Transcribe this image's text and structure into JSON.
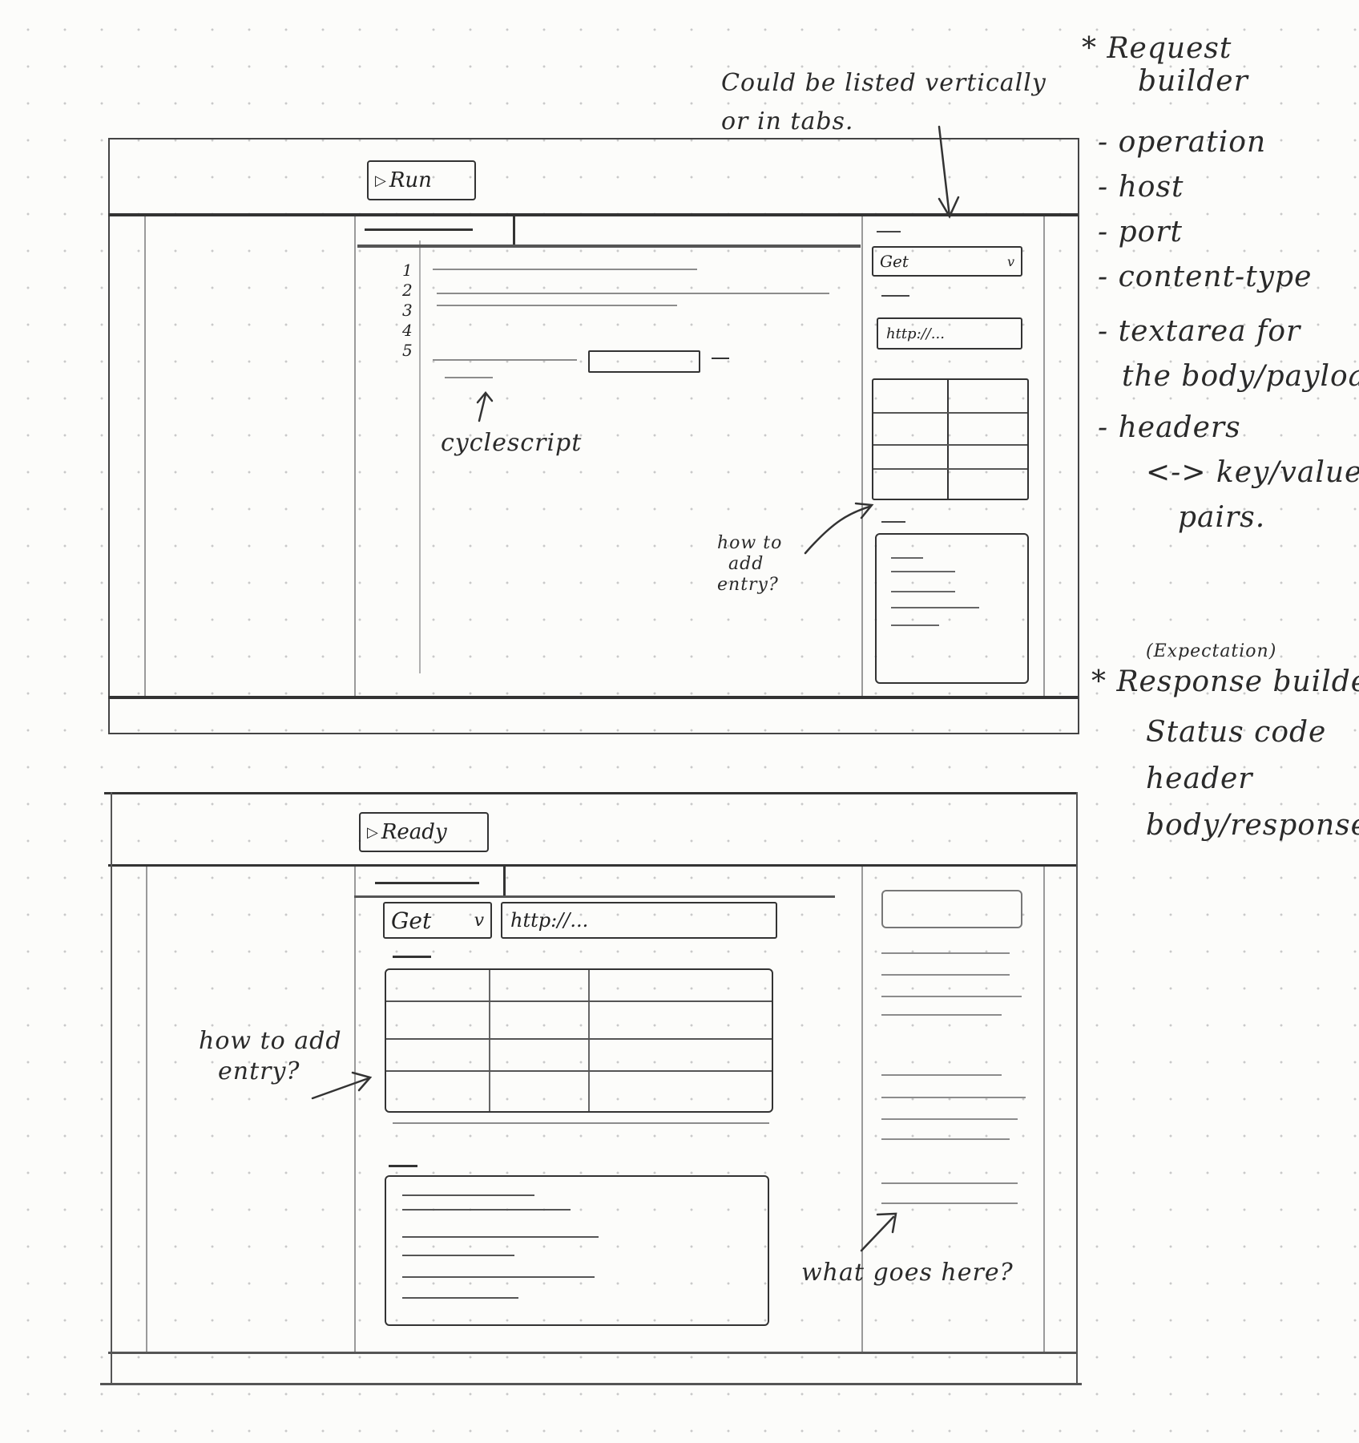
{
  "notes": {
    "vertical": [
      "Could be listed vertically",
      "or in tabs."
    ],
    "request_title": [
      "* Request",
      "builder"
    ],
    "request_items": [
      "- operation",
      "- host",
      "- port",
      "- content-type",
      "- textarea for",
      "the body/payload",
      "- headers",
      "<-> key/value",
      "pairs."
    ],
    "response_paren": "(Expectation)",
    "response_title": "* Response builder",
    "response_items": [
      "Status code",
      "header",
      "body/response"
    ],
    "cyclescript": "cyclescript",
    "how_to_add_1": [
      "how to",
      "add",
      "entry?"
    ],
    "how_to_add_2": [
      "how to add",
      "entry?"
    ],
    "what_goes": "what goes here?"
  },
  "sketch1": {
    "run_button": "Run",
    "line_numbers": [
      "1",
      "2",
      "3",
      "4",
      "5"
    ],
    "method_select": "Get",
    "method_caret": "v",
    "url_input": "http://..."
  },
  "sketch2": {
    "ready_button": "Ready",
    "method_select": "Get",
    "method_caret": "v",
    "url_input": "http://..."
  },
  "icons": {
    "play": "play-icon",
    "caret": "chevron-down-icon"
  }
}
